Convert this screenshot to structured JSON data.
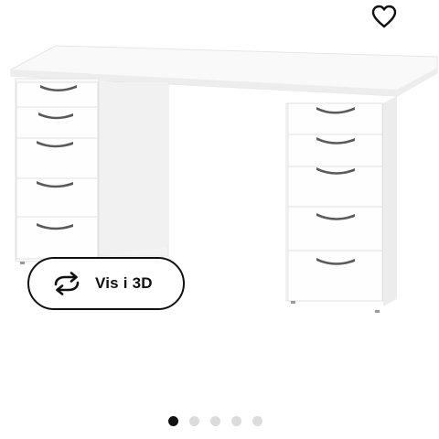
{
  "product": {
    "view3d_label": "Vis i 3D"
  },
  "icons": {
    "favourite": "heart-icon",
    "rotate": "rotate-3d-icon"
  },
  "carousel": {
    "total": 5,
    "active_index": 0
  },
  "colors": {
    "dot_active": "#111111",
    "dot_inactive": "#dcdcdc"
  }
}
